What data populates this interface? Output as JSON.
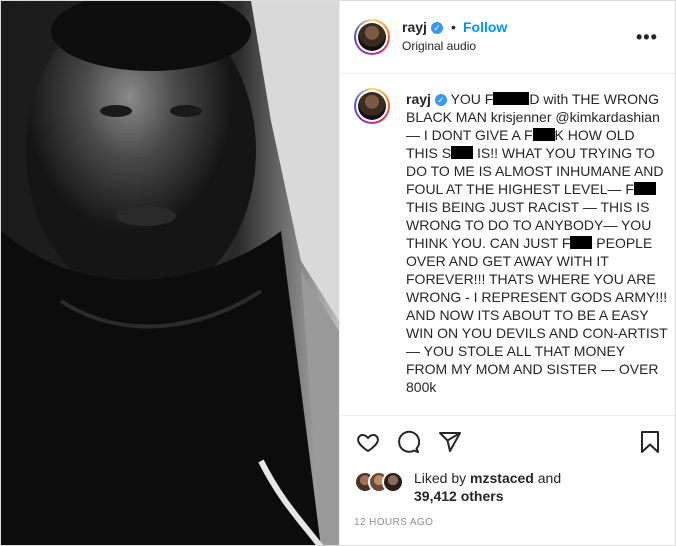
{
  "post": {
    "username": "rayj",
    "separator": "•",
    "follow_label": "Follow",
    "audio_label": "Original audio",
    "more_icon": "more-options-icon",
    "caption_segments": [
      {
        "text": "YOU F",
        "redact": false
      },
      {
        "text": "",
        "redact": true
      },
      {
        "text": "D with THE WRONG BLACK MAN krisjenner @kimkardashian — I DONT GIVE A F",
        "redact": false
      },
      {
        "text": "",
        "redact": true
      },
      {
        "text": "K HOW OLD THIS S",
        "redact": false
      },
      {
        "text": "",
        "redact": true
      },
      {
        "text": " IS!! WHAT YOU TRYING TO DO TO ME IS ALMOST INHUMANE AND FOUL AT THE HIGHEST LEVEL— F",
        "redact": false
      },
      {
        "text": "",
        "redact": true
      },
      {
        "text": " THIS BEING JUST RACIST — THIS IS WRONG TO DO TO ANYBODY— YOU THINK YOU. CAN JUST F",
        "redact": false
      },
      {
        "text": "",
        "redact": true
      },
      {
        "text": " PEOPLE OVER AND GET AWAY WITH IT FOREVER!!! THATS WHERE YOU ARE WRONG - I REPRESENT GODS ARMY!!! AND NOW ITS ABOUT TO BE A EASY WIN ON YOU DEVILS AND CON-ARTIST — YOU STOLE ALL THAT MONEY FROM MY MOM AND SISTER — OVER 800k",
        "redact": false
      }
    ],
    "likes": {
      "prefix": "Liked by ",
      "first_user": "mzstaced",
      "and": " and",
      "count": "39,412 others"
    },
    "timestamp": "12 HOURS AGO"
  },
  "colors": {
    "accent": "#0095f6",
    "verified": "#3897f0",
    "text": "#262626",
    "muted": "#8e8e8e"
  },
  "icons": [
    "heart-icon",
    "comment-icon",
    "share-icon",
    "bookmark-icon",
    "verified-badge-icon"
  ]
}
